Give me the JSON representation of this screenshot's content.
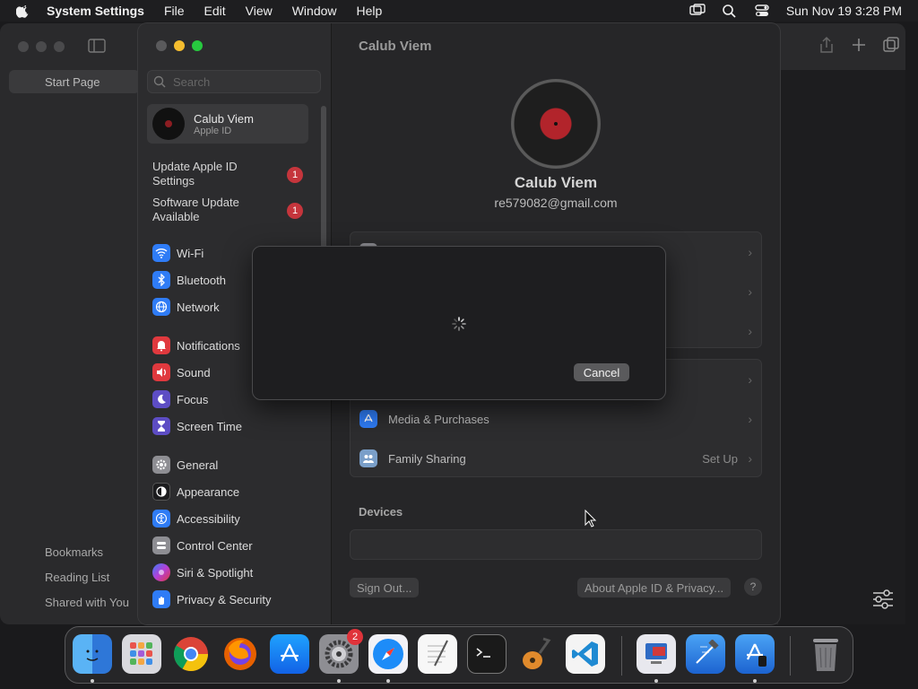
{
  "menubar": {
    "app_name": "System Settings",
    "items": [
      "File",
      "Edit",
      "View",
      "Window",
      "Help"
    ],
    "datetime": "Sun Nov 19  3:28 PM"
  },
  "safari": {
    "start_page": "Start Page",
    "sidebar_links": [
      "Bookmarks",
      "Reading List",
      "Shared with You"
    ]
  },
  "settings": {
    "search_placeholder": "Search",
    "account": {
      "name": "Calub Viem",
      "subtitle": "Apple ID"
    },
    "notices": [
      {
        "label": "Update Apple ID Settings",
        "badge": "1"
      },
      {
        "label": "Software Update Available",
        "badge": "1"
      }
    ],
    "nav": [
      {
        "label": "Wi-Fi",
        "icon": "wifi-icon",
        "color": "#2f7cf6"
      },
      {
        "label": "Bluetooth",
        "icon": "bluetooth-icon",
        "color": "#2f7cf6"
      },
      {
        "label": "Network",
        "icon": "globe-icon",
        "color": "#2f7cf6"
      },
      {
        "label": "Notifications",
        "icon": "bell-icon",
        "color": "#e0393e"
      },
      {
        "label": "Sound",
        "icon": "speaker-icon",
        "color": "#e0393e"
      },
      {
        "label": "Focus",
        "icon": "moon-icon",
        "color": "#5d4dc4"
      },
      {
        "label": "Screen Time",
        "icon": "hourglass-icon",
        "color": "#5d4dc4"
      },
      {
        "label": "General",
        "icon": "gear-icon",
        "color": "#8e8e93"
      },
      {
        "label": "Appearance",
        "icon": "appearance-icon",
        "color": "#1c1c1e"
      },
      {
        "label": "Accessibility",
        "icon": "accessibility-icon",
        "color": "#2f7cf6"
      },
      {
        "label": "Control Center",
        "icon": "control-center-icon",
        "color": "#8e8e93"
      },
      {
        "label": "Siri & Spotlight",
        "icon": "siri-icon",
        "color": "#b53fd6"
      },
      {
        "label": "Privacy & Security",
        "icon": "hand-icon",
        "color": "#2f7cf6"
      }
    ],
    "main": {
      "title": "Calub Viem",
      "user_name": "Calub Viem",
      "user_email": "re579082@gmail.com",
      "rows": [
        {
          "label": "Media & Purchases",
          "value": "",
          "icon": "app-store-icon",
          "color": "#2f7cf6"
        },
        {
          "label": "Family Sharing",
          "value": "Set Up",
          "icon": "family-icon",
          "color": "#7a9fc9"
        }
      ],
      "devices_label": "Devices",
      "sign_out": "Sign Out...",
      "about": "About Apple ID & Privacy...",
      "help": "?"
    },
    "dialog": {
      "cancel": "Cancel"
    }
  },
  "dock": {
    "apps": [
      "Finder",
      "Launchpad",
      "Chrome",
      "Firefox",
      "App Store",
      "System Settings",
      "Safari",
      "TextEdit",
      "Terminal",
      "GarageBand",
      "VS Code",
      "Remote Desktop",
      "Xcode",
      "Simulator",
      "Trash"
    ],
    "settings_badge": "2"
  }
}
